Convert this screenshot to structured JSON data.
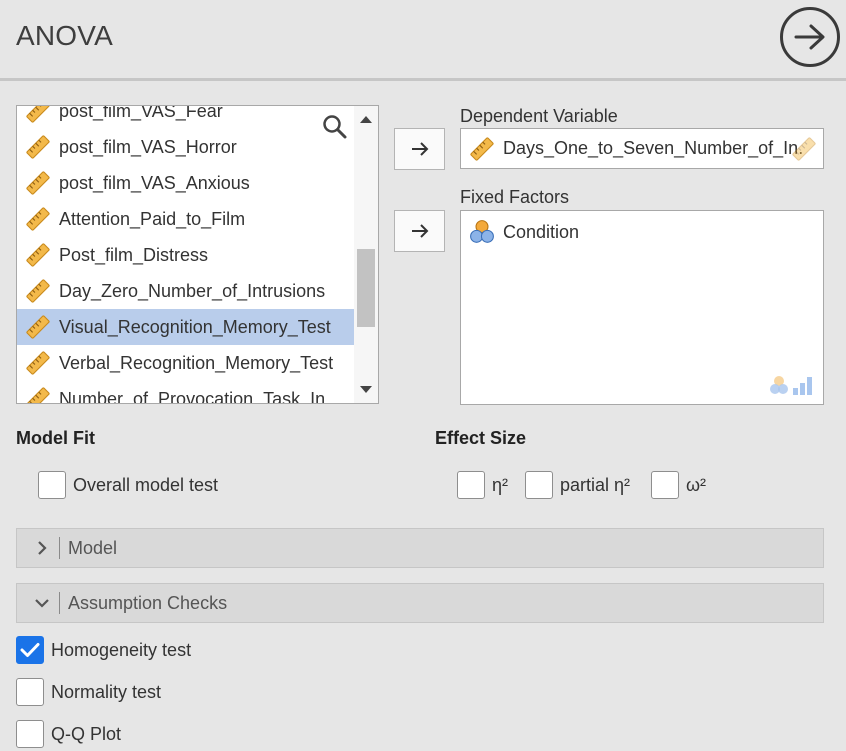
{
  "header": {
    "title": "ANOVA",
    "action_icon": "arrow-right-circle-icon"
  },
  "variables": {
    "items": [
      "post_film_VAS_Fear",
      "post_film_VAS_Horror",
      "post_film_VAS_Anxious",
      "Attention_Paid_to_Film",
      "Post_film_Distress",
      "Day_Zero_Number_of_Intrusions",
      "Visual_Recognition_Memory_Test",
      "Verbal_Recognition_Memory_Test",
      "Number_of_Provocation_Task_In..."
    ],
    "selected": "Visual_Recognition_Memory_Test"
  },
  "dependent": {
    "label": "Dependent Variable",
    "value": "Days_One_to_Seven_Number_of_In..."
  },
  "fixed": {
    "label": "Fixed Factors",
    "items": [
      "Condition"
    ]
  },
  "model_fit": {
    "title": "Model Fit",
    "overall_label": "Overall model test",
    "overall_checked": false
  },
  "effect_size": {
    "title": "Effect Size",
    "eta": "η²",
    "partial_eta": "partial η²",
    "omega": "ω²"
  },
  "sections": {
    "model": "Model",
    "assumption": "Assumption Checks"
  },
  "assumption": {
    "homogeneity": "Homogeneity test",
    "homogeneity_checked": true,
    "normality": "Normality test",
    "qq": "Q-Q Plot"
  },
  "colors": {
    "accent": "#1a73e8",
    "selection": "#b9cdeb",
    "ruler": "#f0b43c",
    "factor_orange": "#f3a93b",
    "factor_blue": "#5a8fd6"
  }
}
